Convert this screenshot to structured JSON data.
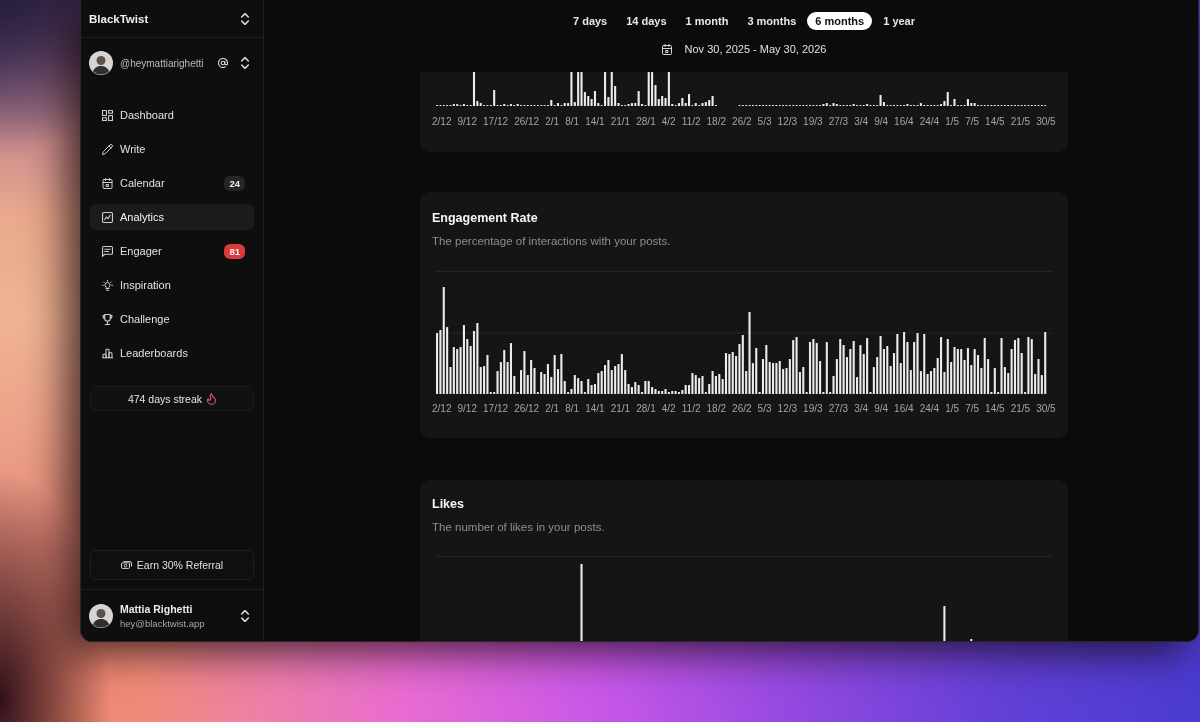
{
  "sidebar": {
    "workspace": "BlackTwist",
    "account": {
      "handle": "@heymattiarighetti"
    },
    "nav": [
      {
        "label": "Dashboard",
        "selected": false
      },
      {
        "label": "Write",
        "selected": false
      },
      {
        "label": "Calendar",
        "selected": false,
        "badge": {
          "text": "24",
          "color": "#262626"
        }
      },
      {
        "label": "Analytics",
        "selected": true
      },
      {
        "label": "Engager",
        "selected": false,
        "badge": {
          "text": "81",
          "color": "#d93b3b"
        }
      },
      {
        "label": "Inspiration",
        "selected": false
      },
      {
        "label": "Challenge",
        "selected": false
      },
      {
        "label": "Leaderboards",
        "selected": false
      }
    ],
    "streak": "474 days streak",
    "referral": "Earn 30% Referral",
    "user": {
      "name": "Mattia Righetti",
      "email": "hey@blacktwist.app"
    }
  },
  "range_tabs": [
    {
      "label": "7 days",
      "selected": false
    },
    {
      "label": "14 days",
      "selected": false
    },
    {
      "label": "1 month",
      "selected": false
    },
    {
      "label": "3 months",
      "selected": false
    },
    {
      "label": "6 months",
      "selected": true
    },
    {
      "label": "1 year",
      "selected": false
    }
  ],
  "date_range": "Nov 30, 2025 - May 30, 2026",
  "charts": [
    {
      "x_labels": [
        "2/12",
        "9/12",
        "17/12",
        "26/12",
        "2/1",
        "8/1",
        "14/1",
        "21/1",
        "28/1",
        "4/2",
        "11/2",
        "18/2",
        "26/2",
        "5/3",
        "12/3",
        "19/3",
        "27/3",
        "3/4",
        "9/4",
        "16/4",
        "24/4",
        "1/5",
        "7/5",
        "14/5",
        "21/5",
        "30/5"
      ]
    },
    {
      "title": "Engagement Rate",
      "subtitle": "The percentage of interactions with your posts.",
      "x_labels": [
        "2/12",
        "9/12",
        "17/12",
        "26/12",
        "2/1",
        "8/1",
        "14/1",
        "21/1",
        "28/1",
        "4/2",
        "11/2",
        "18/2",
        "26/2",
        "5/3",
        "12/3",
        "19/3",
        "27/3",
        "3/4",
        "9/4",
        "16/4",
        "24/4",
        "1/5",
        "7/5",
        "14/5",
        "21/5",
        "30/5"
      ]
    },
    {
      "title": "Likes",
      "subtitle": "The number of likes in your posts."
    }
  ]
}
